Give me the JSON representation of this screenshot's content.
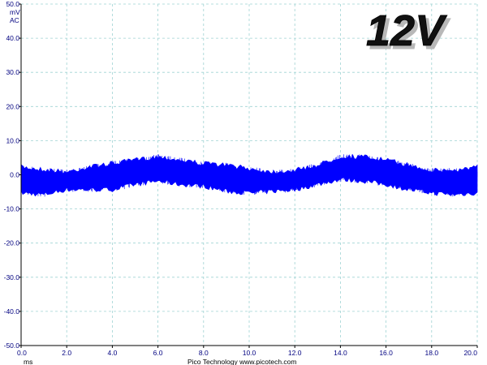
{
  "chart_data": {
    "type": "line",
    "title": "12V",
    "ylabel_unit": "mV",
    "ylabel_coupling": "AC",
    "xlabel": "ms",
    "footer": "Pico Technology  www.picotech.com",
    "xlim": [
      0,
      20
    ],
    "ylim": [
      -50,
      50
    ],
    "x_ticks": [
      "0.0",
      "2.0",
      "4.0",
      "6.0",
      "8.0",
      "10.0",
      "12.0",
      "14.0",
      "16.0",
      "18.0",
      "20.0"
    ],
    "y_ticks": [
      "50.0",
      "40.0",
      "30.0",
      "20.0",
      "10.0",
      "0.0",
      "-10.0",
      "-20.0",
      "-30.0",
      "-40.0",
      "-50.0"
    ],
    "grid": true,
    "series": [
      {
        "color": "#0000ff",
        "envelope_x": [
          0,
          1,
          2,
          3,
          4,
          5,
          6,
          7,
          8,
          9,
          10,
          11,
          12,
          13,
          14,
          15,
          16,
          17,
          18,
          19,
          20
        ],
        "envelope_upper": [
          3.0,
          2.2,
          1.5,
          3.0,
          4.0,
          5.0,
          6.0,
          5.0,
          4.0,
          3.5,
          2.5,
          1.5,
          2.0,
          3.5,
          6.0,
          6.0,
          5.0,
          3.5,
          2.0,
          2.0,
          3.0
        ],
        "envelope_lower": [
          -6.0,
          -6.5,
          -5.0,
          -5.0,
          -5.0,
          -3.5,
          -2.5,
          -3.5,
          -4.0,
          -5.5,
          -6.0,
          -5.5,
          -5.0,
          -3.5,
          -2.0,
          -2.5,
          -3.5,
          -5.0,
          -6.0,
          -6.5,
          -6.0
        ]
      }
    ]
  }
}
